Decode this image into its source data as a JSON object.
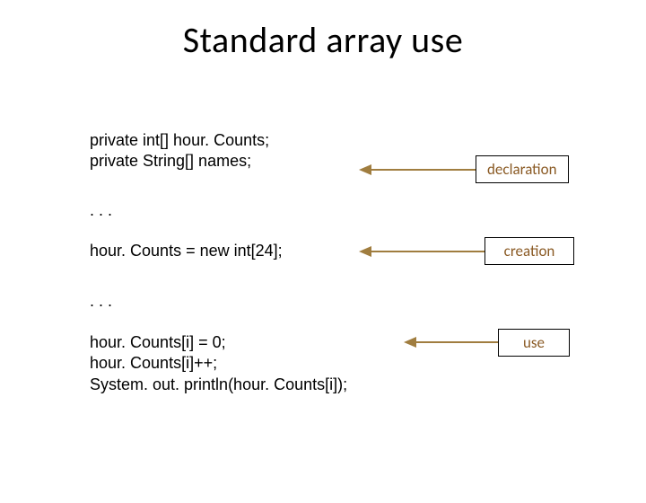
{
  "title": "Standard array use",
  "blocks": {
    "declaration": {
      "line1": "private int[] hour. Counts;",
      "line2": "private String[] names;",
      "label": "declaration"
    },
    "gap1": ". . .",
    "creation": {
      "line1": "hour. Counts = new int[24];",
      "label": "creation"
    },
    "gap2": ". . .",
    "use": {
      "line1": "hour. Counts[i] = 0;",
      "line2": "hour. Counts[i]++;",
      "line3": "System. out. println(hour. Counts[i]);",
      "label": "use"
    }
  },
  "arrow_color": "#a07d3f"
}
